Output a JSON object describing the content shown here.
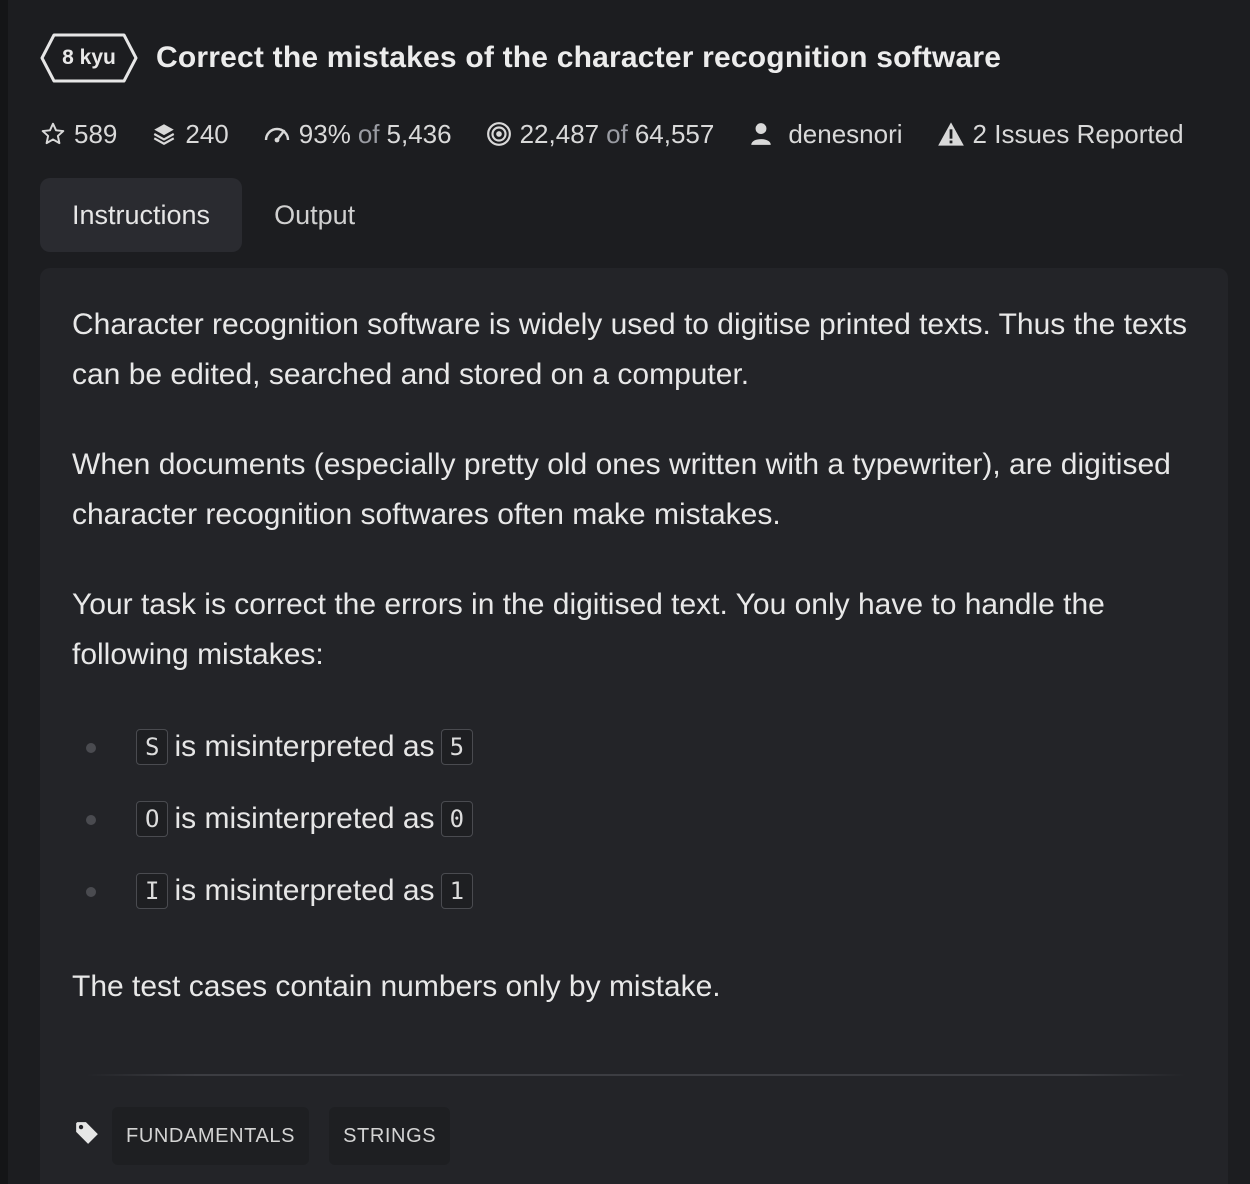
{
  "kata": {
    "rank": "8 kyu",
    "title": "Correct the mistakes of the character recognition software"
  },
  "stats": {
    "stars": "589",
    "collections": "240",
    "satisfaction_pct": "93%",
    "of_word": "of",
    "satisfaction_votes": "5,436",
    "completed": "22,487",
    "attempted": "64,557",
    "author": "denesnori",
    "issues": "2 Issues Reported"
  },
  "tabs": [
    {
      "label": "Instructions",
      "active": true
    },
    {
      "label": "Output",
      "active": false
    }
  ],
  "description": {
    "p1": "Character recognition software is widely used to digitise printed texts. Thus the texts can be edited, searched and stored on a computer.",
    "p2": "When documents (especially pretty old ones written with a typewriter), are digitised character recognition softwares often make mistakes.",
    "p3": "Your task is correct the errors in the digitised text. You only have to handle the following mistakes:",
    "rules": [
      {
        "from": "S",
        "text": "is misinterpreted as",
        "to": "5"
      },
      {
        "from": "O",
        "text": "is misinterpreted as",
        "to": "0"
      },
      {
        "from": "I",
        "text": "is misinterpreted as",
        "to": "1"
      }
    ],
    "p4": "The test cases contain numbers only by mistake."
  },
  "tags": [
    "FUNDAMENTALS",
    "STRINGS"
  ],
  "icons": [
    "star-icon",
    "collections-icon",
    "satisfaction-gauge-icon",
    "target-icon",
    "user-icon",
    "warning-icon",
    "tag-icon"
  ],
  "colors": {
    "background": "#1c1d20",
    "card": "#232428",
    "active_tab": "#2a2b30",
    "text": "#e6e6e6",
    "muted": "#9a9ca3"
  }
}
